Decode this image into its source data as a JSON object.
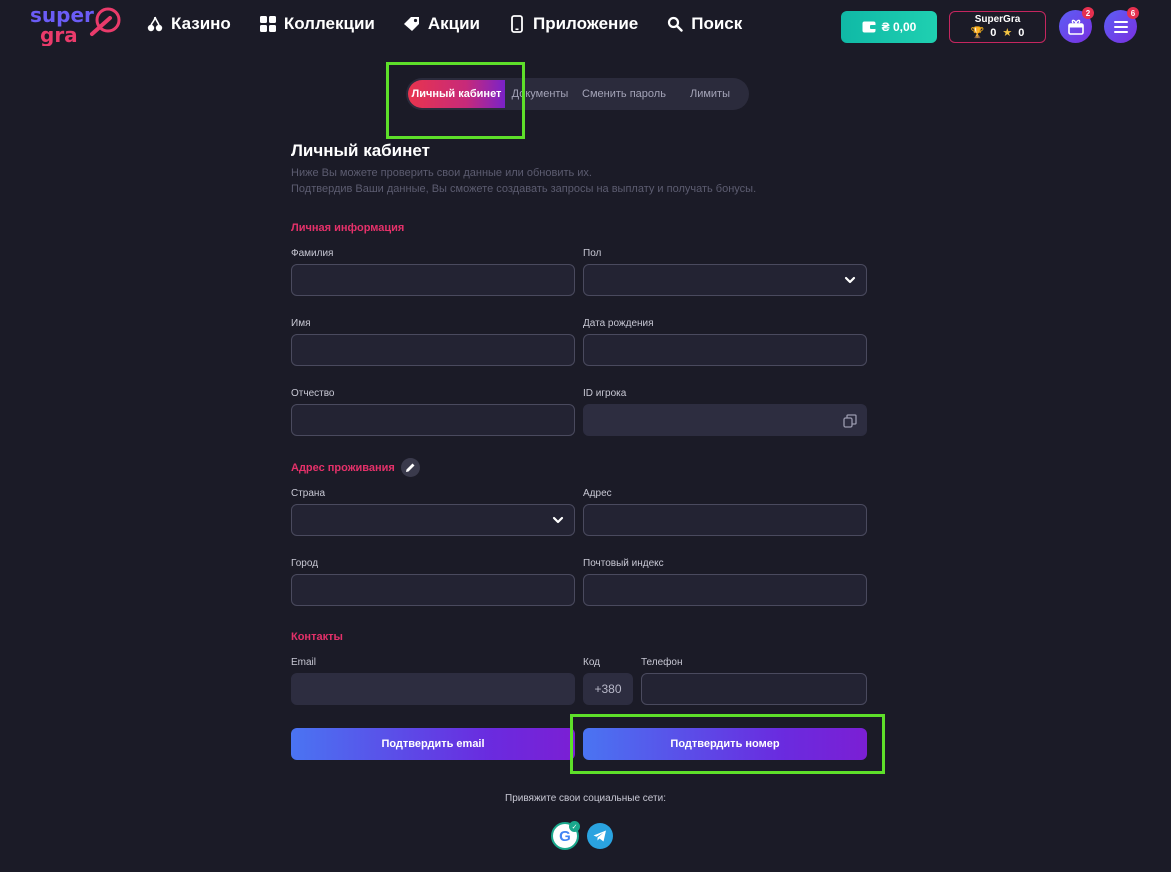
{
  "header": {
    "logo_top": "super",
    "logo_bottom": "gra",
    "nav": [
      {
        "label": "Казино",
        "icon": "cherry-icon"
      },
      {
        "label": "Коллекции",
        "icon": "grid-icon"
      },
      {
        "label": "Акции",
        "icon": "tag-icon"
      },
      {
        "label": "Приложение",
        "icon": "phone-icon"
      },
      {
        "label": "Поиск",
        "icon": "search-icon"
      }
    ],
    "balance": "₴ 0,00",
    "loyalty": {
      "name": "SuperGra",
      "trophies": "0",
      "stars": "0"
    },
    "gift_badge": "2",
    "menu_badge": "6"
  },
  "tabs": [
    {
      "label": "Личный кабинет",
      "active": true
    },
    {
      "label": "Документы"
    },
    {
      "label": "Сменить пароль"
    },
    {
      "label": "Лимиты"
    }
  ],
  "page": {
    "title": "Личный кабинет",
    "subtitle_1": "Ниже Вы можете проверить свои данные или обновить их.",
    "subtitle_2": "Подтвердив Ваши данные, Вы сможете создавать запросы на выплату и получать бонусы."
  },
  "personal": {
    "heading": "Личная информация",
    "surname_label": "Фамилия",
    "gender_label": "Пол",
    "name_label": "Имя",
    "birth_label": "Дата рождения",
    "patronymic_label": "Отчество",
    "player_id_label": "ID игрока"
  },
  "address": {
    "heading": "Адрес проживания",
    "country_label": "Страна",
    "address_label": "Адрес",
    "city_label": "Город",
    "zip_label": "Почтовый индекс"
  },
  "contacts": {
    "heading": "Контакты",
    "email_label": "Email",
    "code_label": "Код",
    "code_value": "+380",
    "phone_label": "Телефон"
  },
  "buttons": {
    "confirm_email": "Подтвердить email",
    "confirm_phone": "Подтвердить номер"
  },
  "social": {
    "text": "Привяжите свои социальные сети:",
    "google_letter": "G"
  },
  "colors": {
    "background": "#1b1b27",
    "accent_pink": "#e5316a",
    "highlight": "#5ee02a",
    "balance": "#10b9a6"
  }
}
